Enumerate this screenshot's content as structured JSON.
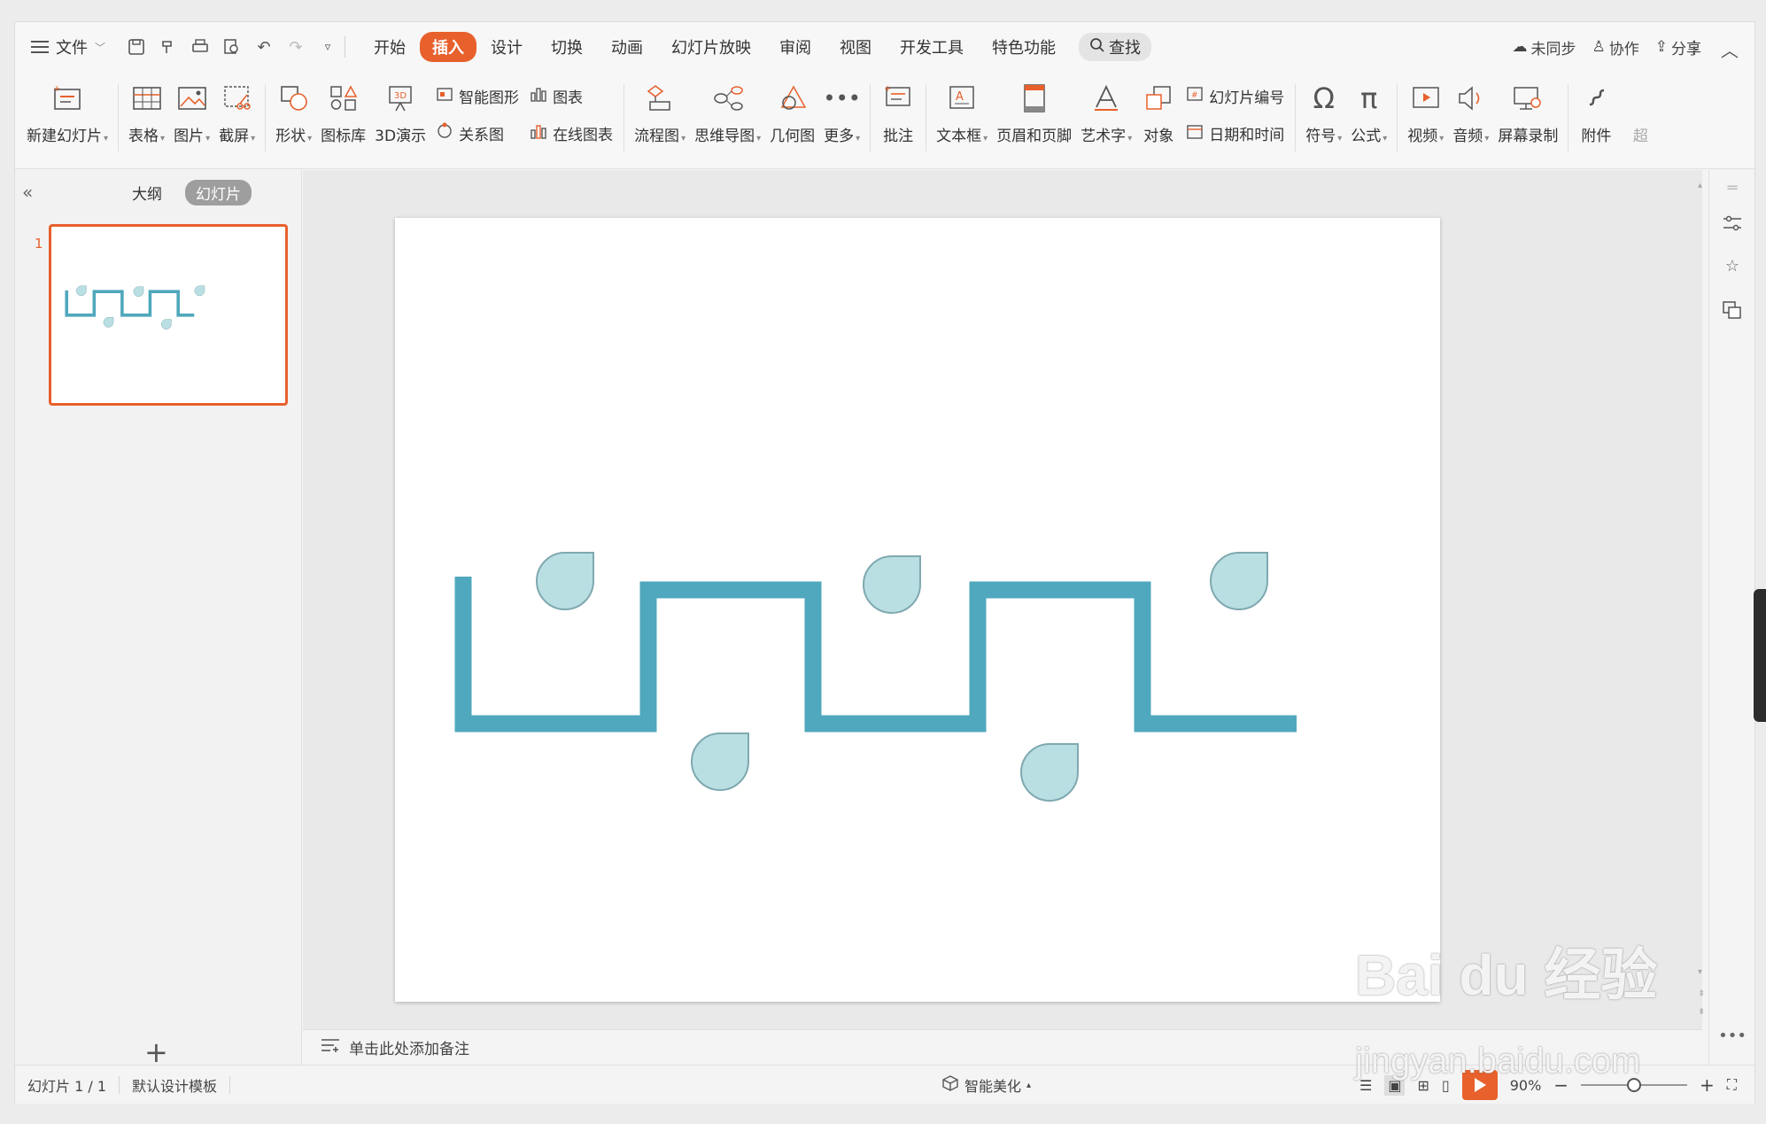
{
  "menubar": {
    "file_label": "文件",
    "tabs": [
      {
        "label": "开始"
      },
      {
        "label": "插入"
      },
      {
        "label": "设计"
      },
      {
        "label": "切换"
      },
      {
        "label": "动画"
      },
      {
        "label": "幻灯片放映"
      },
      {
        "label": "审阅"
      },
      {
        "label": "视图"
      },
      {
        "label": "开发工具"
      },
      {
        "label": "特色功能"
      }
    ],
    "active_tab": "插入",
    "search_label": "查找",
    "sync_label": "未同步",
    "collab_label": "协作",
    "share_label": "分享"
  },
  "ribbon": {
    "new_slide": "新建幻灯片",
    "table": "表格",
    "picture": "图片",
    "screenshot": "截屏",
    "shape": "形状",
    "icon_lib": "图标库",
    "threed": "3D演示",
    "smart_graphic": "智能图形",
    "chart": "图表",
    "relation": "关系图",
    "online_chart": "在线图表",
    "flowchart": "流程图",
    "mindmap": "思维导图",
    "geometry": "几何图",
    "more": "更多",
    "comment": "批注",
    "textbox": "文本框",
    "header_footer": "页眉和页脚",
    "wordart": "艺术字",
    "object": "对象",
    "slide_number": "幻灯片编号",
    "datetime": "日期和时间",
    "symbol": "符号",
    "formula": "公式",
    "video": "视频",
    "audio": "音频",
    "screen_record": "屏幕录制",
    "attachment": "附件",
    "overflow": "超"
  },
  "leftpanel": {
    "outline_tab": "大纲",
    "slides_tab": "幻灯片",
    "slide_number": "1"
  },
  "notes": {
    "placeholder": "单击此处添加备注"
  },
  "statusbar": {
    "slide_info": "幻灯片 1 / 1",
    "template": "默认设计模板",
    "beautify": "智能美化",
    "zoom": "90%"
  },
  "colors": {
    "accent": "#e8602c",
    "line": "#4fa8bd",
    "drop_fill": "#b9dfe3",
    "drop_stroke": "#7fa9b0"
  },
  "watermark": {
    "brand": "Bai du 经验",
    "url": "jingyan.baidu.com"
  }
}
